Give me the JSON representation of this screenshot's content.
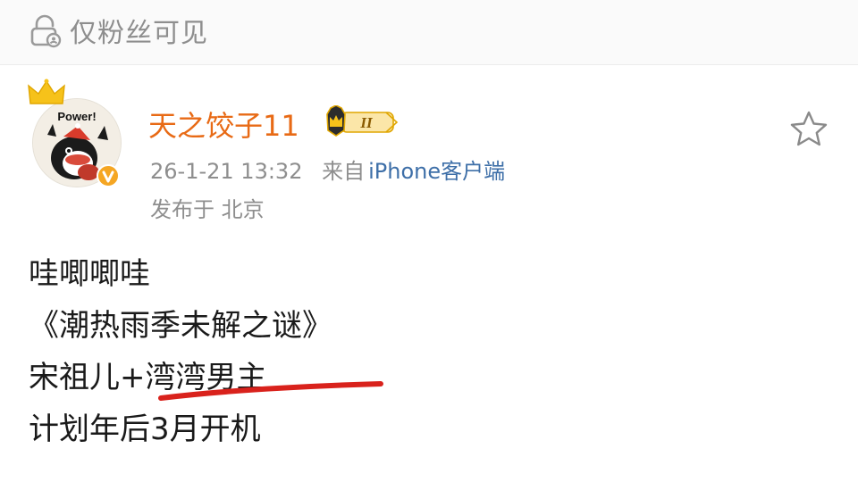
{
  "visibility": {
    "label": "仅粉丝可见",
    "icon": "lock-icon"
  },
  "author": {
    "name": "天之饺子11",
    "avatar_text": "Power!",
    "vip_level": "II",
    "verified_icon": "verified-v-icon",
    "crown_icon": "crown-icon"
  },
  "meta": {
    "timestamp": "26-1-21 13:32",
    "from_label": "来自",
    "client": "iPhone客户端",
    "location": "发布于 北京"
  },
  "actions": {
    "favorite_icon": "star-icon"
  },
  "post": {
    "lines": [
      "哇唧唧哇",
      "《潮热雨季未解之谜》",
      "宋祖儿+湾湾男主",
      "计划年后3月开机"
    ]
  },
  "colors": {
    "author_name": "#e86a15",
    "meta_gray": "#8e8e8e",
    "link_blue": "#3e6fa8",
    "underline_red": "#d9221c",
    "vip_gold": "#f0b429"
  }
}
